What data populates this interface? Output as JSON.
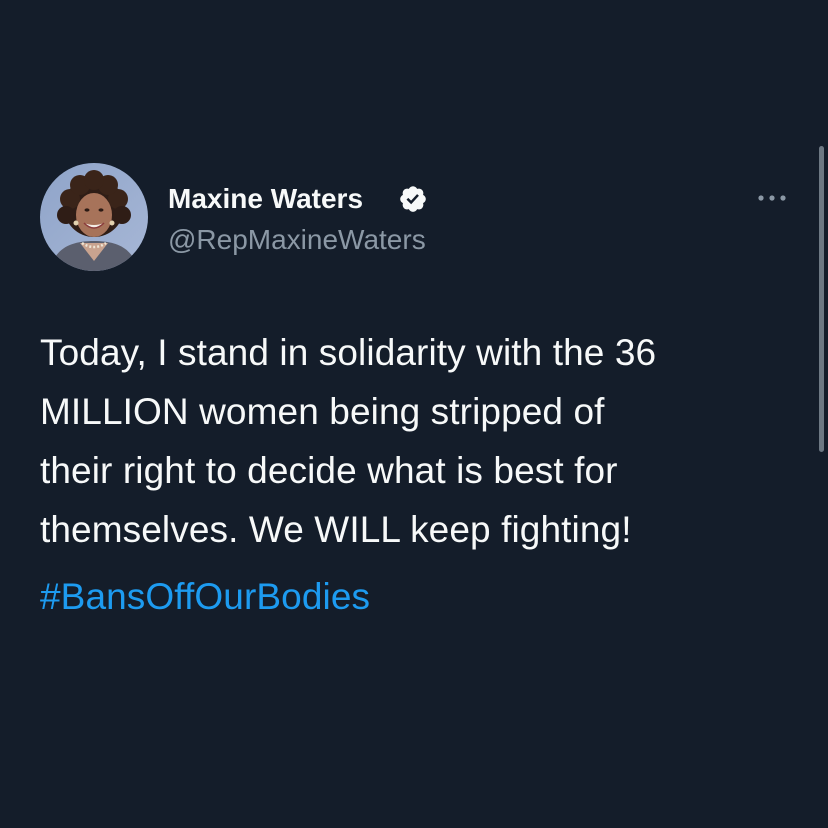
{
  "tweet": {
    "author": {
      "name": "Maxine Waters",
      "handle": "@RepMaxineWaters",
      "verified": true
    },
    "text": "Today, I stand in solidarity with the 36\nMILLION women being stripped of\ntheir right to decide what is best for\nthemselves. We WILL keep fighting!",
    "hashtag": "#BansOffOurBodies"
  },
  "colors": {
    "background": "#141d2a",
    "text": "#f7f9f9",
    "secondary_text": "#8b98a5",
    "link": "#1d9bf0"
  },
  "icons": {
    "verified": "verified-badge-icon",
    "more": "more-horizontal-icon"
  }
}
